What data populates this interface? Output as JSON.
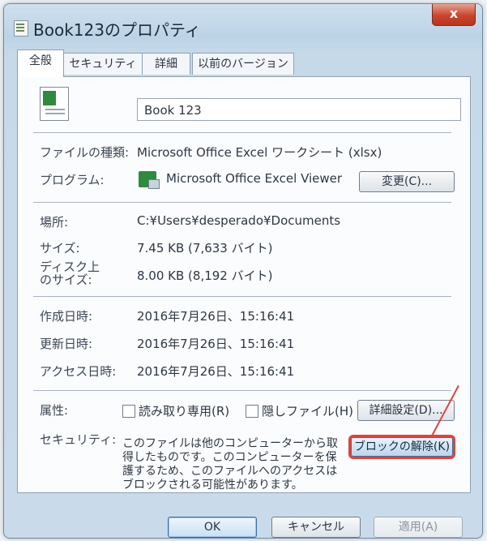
{
  "window": {
    "title": "Book123のプロパティ",
    "close_label": "x"
  },
  "tabs": [
    "全般",
    "セキュリティ",
    "詳細",
    "以前のバージョン"
  ],
  "general": {
    "file_name": "Book 123",
    "rows": {
      "file_type": {
        "label": "ファイルの種類:",
        "value": "Microsoft Office Excel ワークシート (xlsx)"
      },
      "program": {
        "label": "プログラム:",
        "value": "Microsoft Office Excel Viewer",
        "change_button": "変更(C)..."
      },
      "location": {
        "label": "場所:",
        "value": "C:¥Users¥desperado¥Documents"
      },
      "size": {
        "label": "サイズ:",
        "value": "7.45 KB (7,633 バイト)"
      },
      "disk_size": {
        "label_line1": "ディスク上",
        "label_line2": "のサイズ:",
        "value": "8.00 KB (8,192 バイト)"
      },
      "created": {
        "label": "作成日時:",
        "value": "2016年7月26日、15:16:41"
      },
      "modified": {
        "label": "更新日時:",
        "value": "2016年7月26日、15:16:41"
      },
      "accessed": {
        "label": "アクセス日時:",
        "value": "2016年7月26日、15:16:41"
      }
    },
    "attributes": {
      "label": "属性:",
      "readonly": "読み取り専用(R)",
      "hidden": "隠しファイル(H)",
      "advanced_button": "詳細設定(D)..."
    },
    "security": {
      "label": "セキュリティ:",
      "text": "このファイルは他のコンピューターから取得したものです。このコンピューターを保護するため、このファイルへのアクセスはブロックされる可能性があります。",
      "unblock_button": "ブロックの解除(K)"
    }
  },
  "buttons": {
    "ok": "OK",
    "cancel": "キャンセル",
    "apply": "適用(A)"
  }
}
